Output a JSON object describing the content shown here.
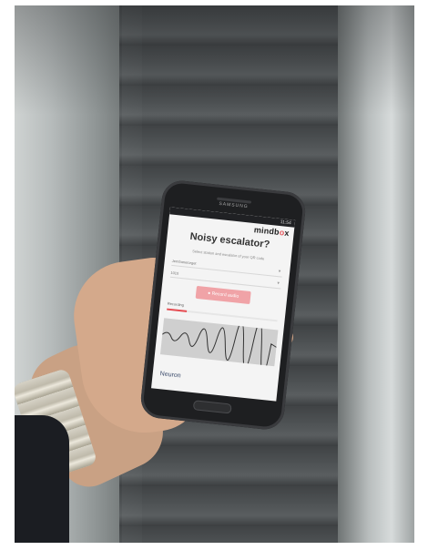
{
  "phone": {
    "brand_hardware": "SAMSUNG",
    "status_time": "11:54",
    "app": {
      "logo": "mindbox",
      "title": "Noisy escalator?",
      "subtitle": "Select station and escalator of your QR code",
      "station_field": "Jernbanetorget",
      "escalator_field": "1010",
      "record_button": "Record audio",
      "recording_label": "Recording",
      "recording_progress": 0.18,
      "footer_logo": "Neuron"
    }
  },
  "colors": {
    "accent": "#e45a5f",
    "record_button": "#f0a3a7",
    "progress": "#e64a50"
  },
  "icons": [
    "microphone-icon",
    "chevron-down-icon"
  ]
}
